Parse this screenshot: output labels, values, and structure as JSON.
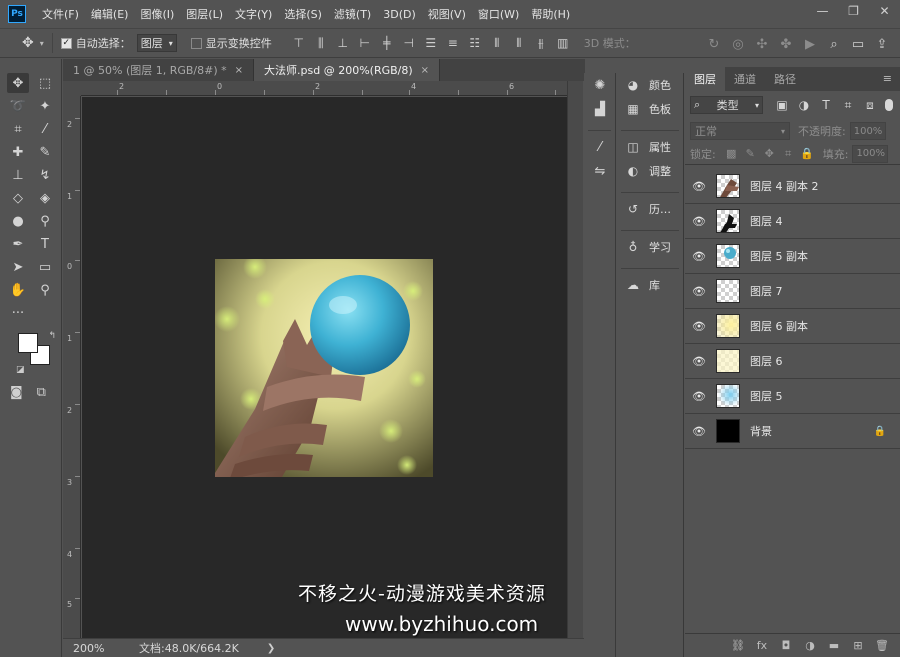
{
  "app": {
    "logo": "Ps"
  },
  "menu": [
    "文件(F)",
    "编辑(E)",
    "图像(I)",
    "图层(L)",
    "文字(Y)",
    "选择(S)",
    "滤镜(T)",
    "3D(D)",
    "视图(V)",
    "窗口(W)",
    "帮助(H)"
  ],
  "window_controls": {
    "minimize": "—",
    "restore": "❐",
    "close": "✕"
  },
  "options": {
    "auto_select_label": "自动选择：",
    "auto_select_value": "图层",
    "show_transform_label": "显示变换控件",
    "mode_3d_label": "3D 模式："
  },
  "tabs": [
    {
      "label": "1 @ 50% (图层 1, RGB/8#) *",
      "close": "×"
    },
    {
      "label": "大法师.psd @ 200%(RGB/8)",
      "close": "×"
    }
  ],
  "ruler": {
    "top": [
      "2",
      "0",
      "2",
      "4",
      "6",
      "8",
      "10"
    ],
    "left": [
      "2",
      "1",
      "0",
      "1",
      "2",
      "3",
      "4",
      "5",
      "6",
      "7"
    ]
  },
  "status": {
    "zoom": "200%",
    "doc_info": "文档:48.0K/664.2K",
    "arrow": "❯"
  },
  "side_panels": [
    {
      "icon": "palette-icon",
      "label": "颜色"
    },
    {
      "icon": "grid-icon",
      "label": "色板"
    },
    {
      "icon": "properties-icon",
      "label": "属性"
    },
    {
      "icon": "adjust-icon",
      "label": "调整"
    },
    {
      "icon": "history-icon",
      "label": "历…"
    },
    {
      "icon": "bulb-icon",
      "label": "学习"
    },
    {
      "icon": "library-icon",
      "label": "库"
    }
  ],
  "layers_panel": {
    "tabs": [
      "图层",
      "通道",
      "路径"
    ],
    "filter_label": "类型",
    "blend_mode": "正常",
    "opacity_label": "不透明度:",
    "opacity_value": "100%",
    "lock_label": "锁定:",
    "fill_label": "填充:",
    "fill_value": "100%",
    "layers": [
      {
        "name": "图层 4 副本 2",
        "thumb": "staff-brown"
      },
      {
        "name": "图层 4",
        "thumb": "staff-black"
      },
      {
        "name": "图层 5 副本",
        "thumb": "orb-small"
      },
      {
        "name": "图层 7",
        "thumb": "empty"
      },
      {
        "name": "图层 6 副本",
        "thumb": "yellow-soft"
      },
      {
        "name": "图层 6",
        "thumb": "yellow-pale"
      },
      {
        "name": "图层 5",
        "thumb": "blue-glow"
      },
      {
        "name": "背景",
        "thumb": "black",
        "locked": true
      }
    ]
  },
  "watermark": {
    "line1": "不移之火-动漫游戏美术资源",
    "line2": "www.byzhihuo.com"
  }
}
